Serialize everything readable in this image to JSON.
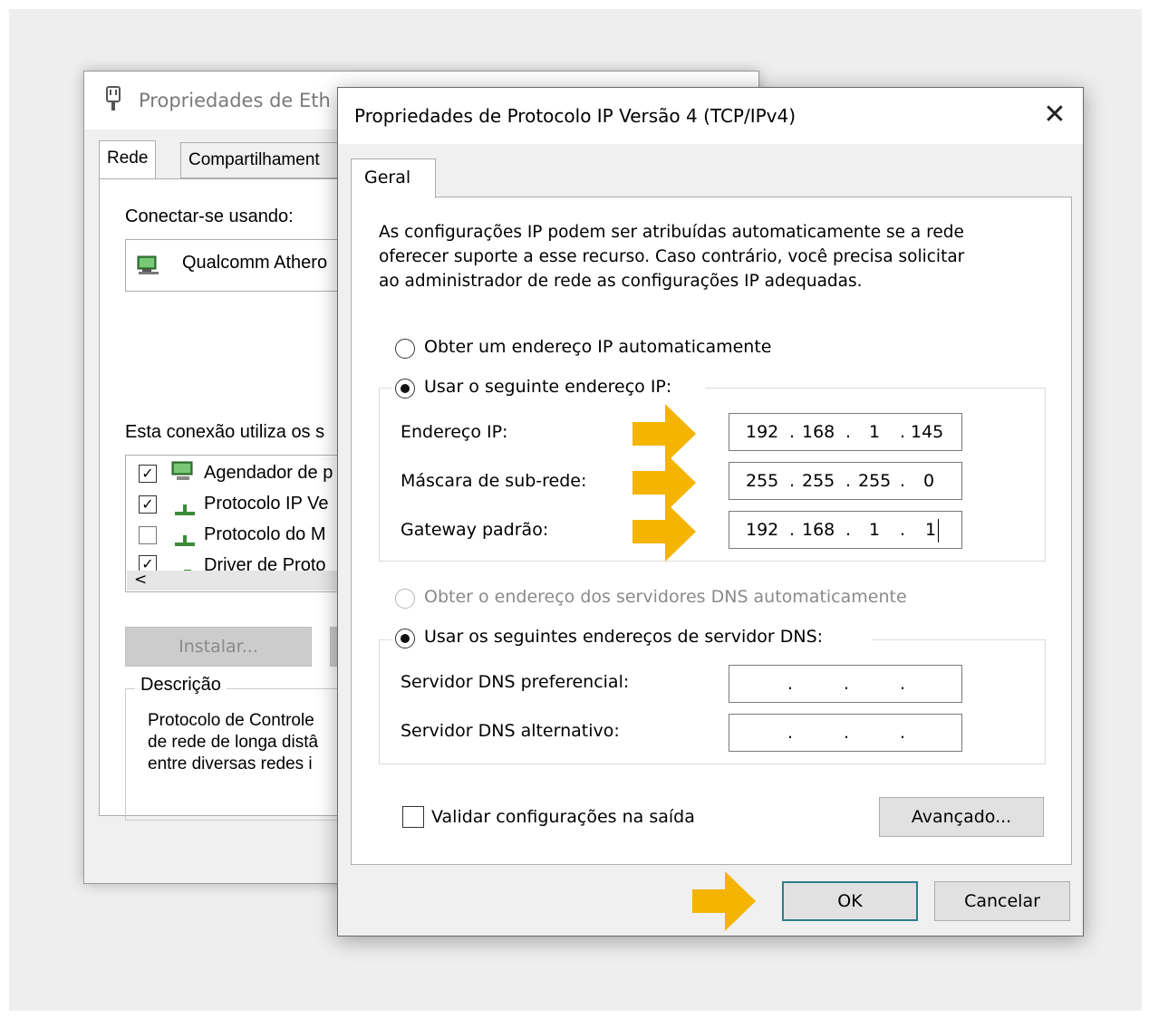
{
  "colors": {
    "arrow": "#f5b400",
    "ok_border": "#2f7f8a"
  },
  "back_window": {
    "title": "Propriedades de Eth",
    "tabs": [
      "Rede",
      "Compartilhament"
    ],
    "connect_label": "Conectar-se usando:",
    "adapter_name": "Qualcomm Athero",
    "uses_label": "Esta conexão utiliza os s",
    "components": [
      {
        "label": "Agendador de p",
        "checked": true
      },
      {
        "label": "Protocolo IP Ve",
        "checked": true
      },
      {
        "label": "Protocolo do M",
        "checked": false
      },
      {
        "label": "Driver de Proto",
        "checked": true
      }
    ],
    "scroll_left": "<",
    "install_button": "Instalar...",
    "description_title": "Descrição",
    "description_lines": [
      "Protocolo de Controle",
      "de rede de longa distâ",
      "entre diversas redes i"
    ]
  },
  "dialog": {
    "title": "Propriedades de Protocolo IP Versão 4 (TCP/IPv4)",
    "close": "✕",
    "tab": "Geral",
    "intro": [
      "As configurações IP podem ser atribuídas automaticamente se a rede",
      "oferecer suporte a esse recurso. Caso contrário, você precisa solicitar",
      "ao administrador de rede as configurações IP adequadas."
    ],
    "radio_auto_ip": "Obter um endereço IP automaticamente",
    "radio_manual_ip": "Usar o seguinte endereço IP:",
    "ip_label": "Endereço IP:",
    "ip_octets": [
      "192",
      "168",
      "1",
      "145"
    ],
    "mask_label": "Máscara de sub-rede:",
    "mask_octets": [
      "255",
      "255",
      "255",
      "0"
    ],
    "gateway_label": "Gateway padrão:",
    "gateway_octets": [
      "192",
      "168",
      "1",
      "1"
    ],
    "radio_auto_dns": "Obter o endereço dos servidores DNS automaticamente",
    "radio_manual_dns": "Usar os seguintes endereços de servidor DNS:",
    "dns_pref_label": "Servidor DNS preferencial:",
    "dns_alt_label": "Servidor DNS alternativo:",
    "dot": ".",
    "validate_label": "Validar configurações na saída",
    "advanced_button": "Avançado...",
    "ok_button": "OK",
    "cancel_button": "Cancelar"
  }
}
